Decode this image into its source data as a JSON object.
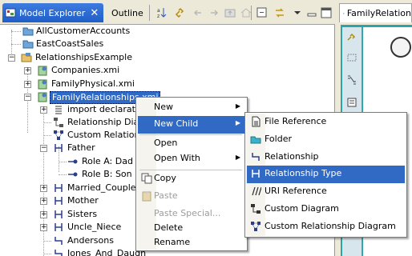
{
  "left_view": {
    "tabs": [
      {
        "label": "Model Explorer",
        "active": true
      },
      {
        "label": "Outline",
        "active": false
      }
    ],
    "tree": [
      {
        "label": "AllCustomerAccounts",
        "icon": "folder-icon"
      },
      {
        "label": "EastCoastSales",
        "icon": "folder-icon"
      },
      {
        "label": "RelationshipsExample",
        "icon": "project-icon",
        "expanded": true
      },
      {
        "label": "Companies.xmi",
        "icon": "xmi-file-icon"
      },
      {
        "label": "FamilyPhysical.xmi",
        "icon": "xmi-file-icon"
      },
      {
        "label": "FamilyRelationships.xmi",
        "icon": "xmi-file-icon",
        "selected": true
      },
      {
        "label": "import declaration",
        "icon": "import-icon"
      },
      {
        "label": "Relationship Diagr",
        "icon": "diagram-icon"
      },
      {
        "label": "Custom Relationsh",
        "icon": "custom-diagram-icon"
      },
      {
        "label": "Father",
        "icon": "relationship-type-icon"
      },
      {
        "label": "Role A: Dad",
        "icon": "role-icon"
      },
      {
        "label": "Role B: Son",
        "icon": "role-icon"
      },
      {
        "label": "Married_Couple",
        "icon": "relationship-type-icon"
      },
      {
        "label": "Mother",
        "icon": "relationship-type-icon"
      },
      {
        "label": "Sisters",
        "icon": "relationship-type-icon"
      },
      {
        "label": "Uncle_Niece",
        "icon": "relationship-type-icon"
      },
      {
        "label": "Andersons",
        "icon": "relationship-icon"
      },
      {
        "label": "Jones_And_Daugh",
        "icon": "relationship-icon"
      }
    ]
  },
  "right_view": {
    "tab_label": "FamilyRelation"
  },
  "context_menu": {
    "items": [
      {
        "label": "New",
        "submenu": true
      },
      {
        "label": "New Child",
        "submenu": true,
        "selected": true
      },
      {
        "label": "Open"
      },
      {
        "label": "Open With",
        "submenu": true
      },
      {
        "label": "Copy",
        "icon": "copy-icon"
      },
      {
        "label": "Paste",
        "icon": "paste-icon",
        "disabled": true
      },
      {
        "label": "Paste Special...",
        "disabled": true
      },
      {
        "label": "Delete"
      },
      {
        "label": "Rename"
      }
    ]
  },
  "submenu": {
    "items": [
      {
        "label": "File Reference",
        "icon": "file-reference-icon"
      },
      {
        "label": "Folder",
        "icon": "folder-icon"
      },
      {
        "label": "Relationship",
        "icon": "relationship-icon"
      },
      {
        "label": "Relationship Type",
        "icon": "relationship-type-icon",
        "selected": true
      },
      {
        "label": "URI Reference",
        "icon": "uri-reference-icon"
      },
      {
        "label": "Custom Diagram",
        "icon": "custom-diagram-icon"
      },
      {
        "label": "Custom Relationship Diagram",
        "icon": "custom-relationship-diagram-icon"
      }
    ]
  },
  "colors": {
    "selection": "#316ac5",
    "active_tab": "#2f6bd6",
    "canvas": "#2aa4a8"
  }
}
